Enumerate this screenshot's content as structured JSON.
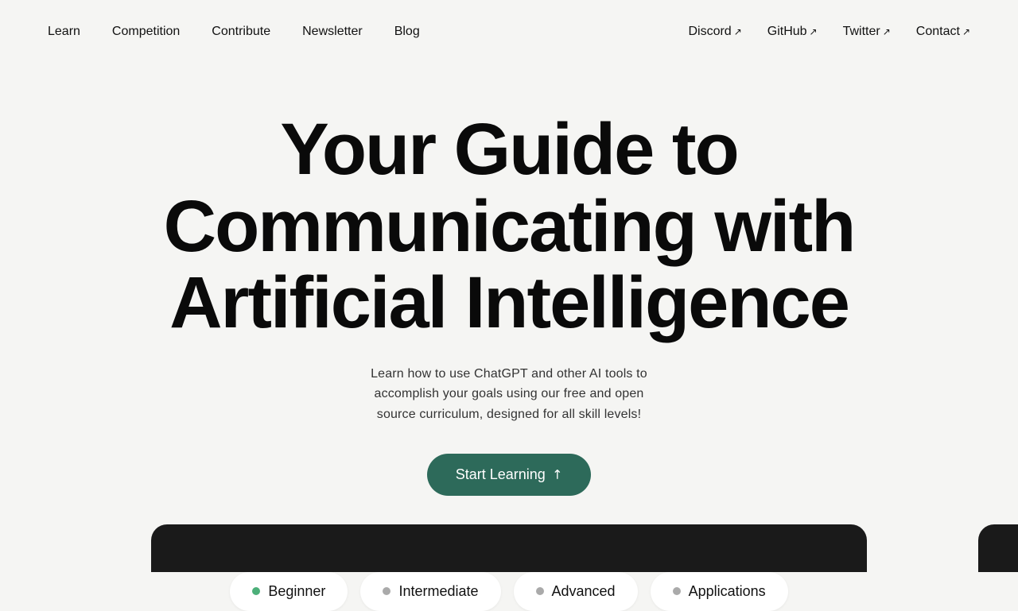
{
  "nav": {
    "left_links": [
      {
        "label": "Learn",
        "external": false
      },
      {
        "label": "Competition",
        "external": false
      },
      {
        "label": "Contribute",
        "external": false
      },
      {
        "label": "Newsletter",
        "external": false
      },
      {
        "label": "Blog",
        "external": false
      }
    ],
    "right_links": [
      {
        "label": "Discord",
        "external": true
      },
      {
        "label": "GitHub",
        "external": true
      },
      {
        "label": "Twitter",
        "external": true
      },
      {
        "label": "Contact",
        "external": true
      }
    ]
  },
  "hero": {
    "title": "Your Guide to Communicating with Artificial Intelligence",
    "subtitle": "Learn how to use ChatGPT and other AI tools to accomplish your goals using our free and open source curriculum, designed for all skill levels!",
    "cta_label": "Start Learning"
  },
  "pills": [
    {
      "label": "Beginner",
      "dot_class": "dot-green"
    },
    {
      "label": "Intermediate",
      "dot_class": "dot-gray"
    },
    {
      "label": "Advanced",
      "dot_class": "dot-gray"
    },
    {
      "label": "Applications",
      "dot_class": "dot-gray"
    }
  ]
}
